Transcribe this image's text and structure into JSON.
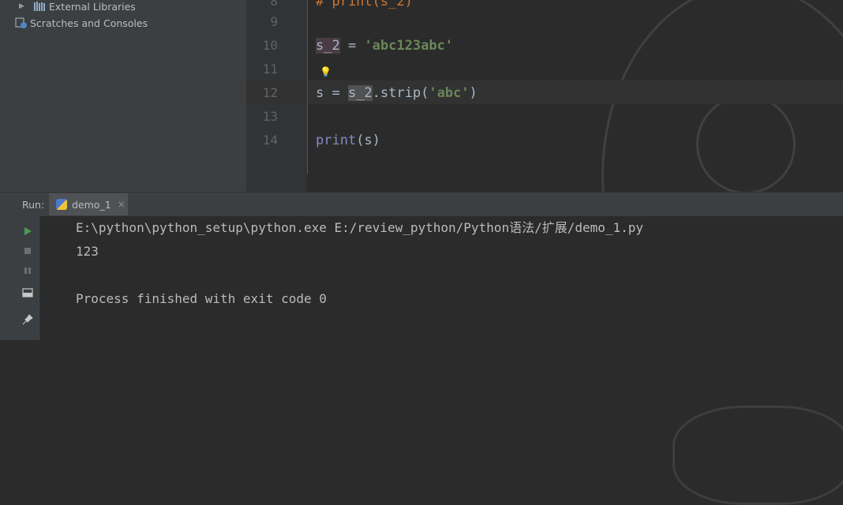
{
  "project_tree": {
    "items": [
      {
        "label": "External Libraries"
      },
      {
        "label": "Scratches and Consoles"
      }
    ]
  },
  "editor": {
    "line_numbers": [
      "8",
      "9",
      "10",
      "11",
      "12",
      "13",
      "14"
    ],
    "lines": {
      "l8_comment": "# print(s_2)",
      "l10_var": "s_2",
      "l10_eq": " = ",
      "l10_str": "'abc123abc'",
      "l12_s": "s = ",
      "l12_var": "s_2",
      "l12_method": ".strip(",
      "l12_str": "'abc'",
      "l12_close": ")",
      "l14_fn": "print",
      "l14_rest": "(s)"
    }
  },
  "run_panel": {
    "label": "Run:",
    "tab_label": "demo_1",
    "close_glyph": "×"
  },
  "console": {
    "command": "E:\\python\\python_setup\\python.exe E:/review_python/Python语法/扩展/demo_1.py",
    "output": "123",
    "exit_message": "Process finished with exit code 0"
  },
  "colors": {
    "background": "#2b2b2b",
    "panel": "#3c3f41",
    "string": "#6a8759",
    "run_green": "#499c54"
  }
}
